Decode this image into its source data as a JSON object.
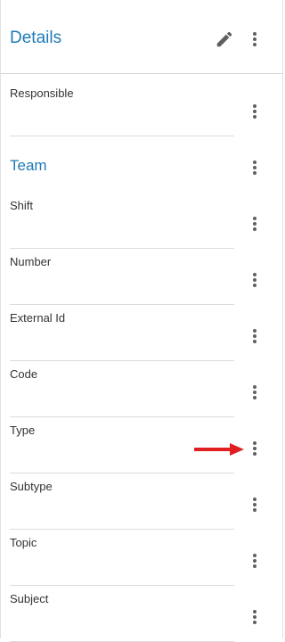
{
  "header": {
    "title": "Details",
    "edit_icon": "pencil-icon",
    "menu_icon": "more-vertical-icon"
  },
  "responsible": {
    "label": "Responsible"
  },
  "team": {
    "title": "Team",
    "fields": [
      {
        "label": "Shift"
      },
      {
        "label": "Number"
      },
      {
        "label": "External Id"
      },
      {
        "label": "Code"
      },
      {
        "label": "Type"
      },
      {
        "label": "Subtype"
      },
      {
        "label": "Topic"
      },
      {
        "label": "Subject"
      }
    ]
  },
  "colors": {
    "accent": "#1f7bb8",
    "icon": "#5f5f5f",
    "annotation_arrow": "#e02020"
  }
}
